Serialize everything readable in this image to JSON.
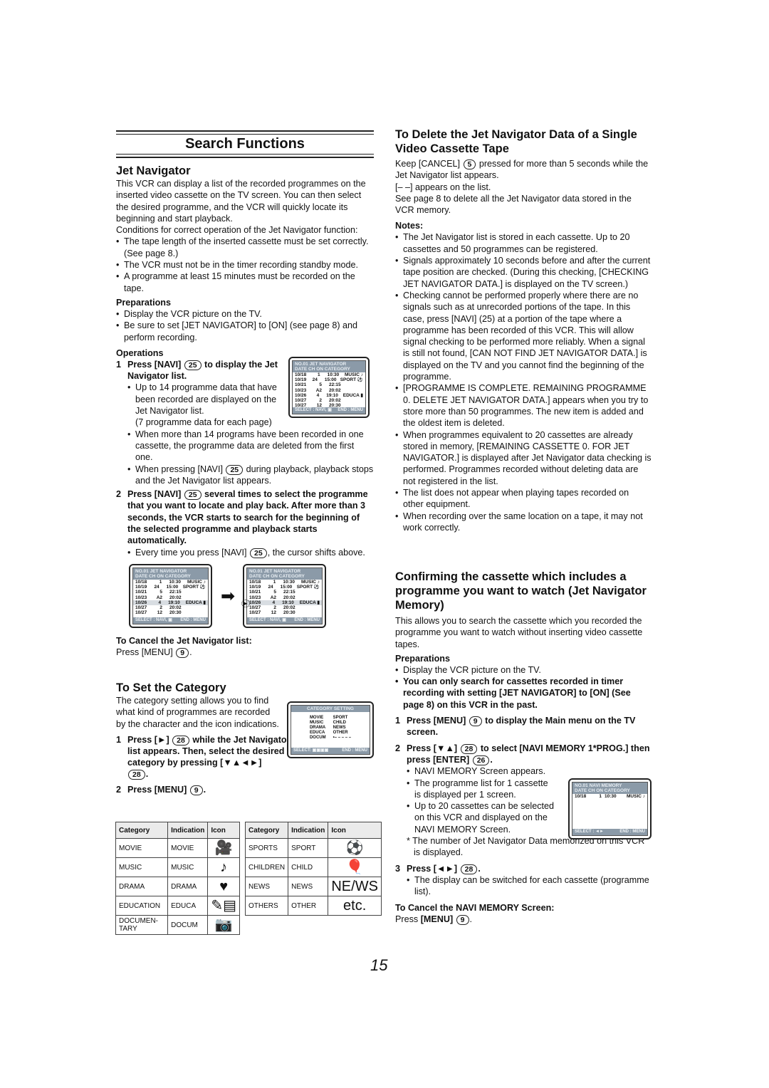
{
  "page_title": "Search Functions",
  "page_number": "15",
  "jet_navigator": {
    "heading": "Jet Navigator",
    "intro": "This VCR can display a list of the recorded programmes on the inserted video cassette on the TV screen. You can then select the desired programme, and the VCR will quickly locate its beginning and start playback.",
    "conditions_intro": "Conditions for correct operation of the Jet Navigator function:",
    "conditions": [
      "The tape length of the inserted cassette must be set correctly. (See page 8.)",
      "The VCR must not be in the timer recording standby mode.",
      "A programme at least 15 minutes must be recorded on the tape."
    ],
    "preparations_heading": "Preparations",
    "preparations": [
      "Display the VCR picture on the TV.",
      "Be sure to set [JET NAVIGATOR] to [ON] (see page 8) and perform recording."
    ],
    "operations_heading": "Operations",
    "step1": {
      "num": "1",
      "pre": "Press [NAVI]",
      "btn": "25",
      "post": "to display the Jet Navigator list."
    },
    "step1_bullet1": "Up to 14 programme data that have been recorded are displayed on the Jet Navigator list.",
    "step1_note": "(7 programme data for each page)",
    "step1_bullet2": "When more than 14 programs have been recorded in one cassette, the programme data are deleted from the first one.",
    "step1_bullet3": {
      "pre": "When pressing [NAVI]",
      "btn": "25",
      "post": "during playback, playback stops and the Jet Navigator list appears."
    },
    "step2": {
      "num": "2",
      "pre": "Press [NAVI]",
      "btn": "25",
      "post": "several times to select the programme that you want to locate and play back. After more than 3 seconds, the VCR starts to search for the beginning of the selected programme and playback starts automatically."
    },
    "step2_bullet": {
      "pre": "Every time you press [NAVI]",
      "btn": "25",
      "post": ", the cursor shifts above."
    },
    "cancel_heading": "To Cancel the Jet Navigator list:",
    "cancel_text": "Press [MENU]",
    "cancel_btn": "9"
  },
  "navi_screen": {
    "header1": "NO.01   JET   NAVIGATOR",
    "header2": "DATE    CH      ON     CATEGORY",
    "rows": [
      {
        "date": "10/18",
        "ch": "1",
        "on": "10:30",
        "cat": "MUSIC ♪"
      },
      {
        "date": "10/19",
        "ch": "24",
        "on": "15:00",
        "cat": "SPORT ⚽"
      },
      {
        "date": "10/21",
        "ch": "5",
        "on": "22:15",
        "cat": ""
      },
      {
        "date": "10/23",
        "ch": "A2",
        "on": "20:02",
        "cat": ""
      },
      {
        "date": "10/26",
        "ch": "4",
        "on": "19:10",
        "cat": "EDUCA ▮"
      },
      {
        "date": "10/27",
        "ch": "2",
        "on": "20:02",
        "cat": ""
      },
      {
        "date": "10/27",
        "ch": "12",
        "on": "20:30",
        "cat": ""
      }
    ],
    "footer_left": "SELECT : NAVI, ▣",
    "footer_right": "END : MENU",
    "arrow": "➡",
    "cursor": "►"
  },
  "category": {
    "heading": "To Set the Category",
    "intro": "The category setting allows you to find what kind of programmes are recorded by the character and the icon indications.",
    "step1": {
      "num": "1",
      "pre": "Press [►]",
      "btn": "28",
      "post": "while the Jet Navigator list appears. Then, select the desired category by pressing [▼▲◄►]",
      "btn2": "28"
    },
    "step2": {
      "num": "2",
      "pre": "Press [MENU]",
      "btn": "9"
    },
    "screen": {
      "title": "CATEGORY SETTING",
      "left": [
        "MOVIE",
        "MUSIC",
        "DRAMA",
        "EDUCA",
        "DOCUM"
      ],
      "right": [
        "SPORT",
        "CHILD",
        "NEWS",
        "OTHER",
        "•– – – – –"
      ],
      "footer_left": "SELECT: ▣▣▣▣",
      "footer_right": "END : MENU"
    },
    "table_headers": [
      "Category",
      "Indication",
      "Icon"
    ],
    "table_left": [
      {
        "category": "MOVIE",
        "indication": "MOVIE",
        "icon": "🎥"
      },
      {
        "category": "MUSIC",
        "indication": "MUSIC",
        "icon": "♪"
      },
      {
        "category": "DRAMA",
        "indication": "DRAMA",
        "icon": "♥"
      },
      {
        "category": "EDUCATION",
        "indication": "EDUCA",
        "icon": "✎▤"
      },
      {
        "category": "DOCUMEN-TARY",
        "indication": "DOCUM",
        "icon": "📷"
      }
    ],
    "table_right": [
      {
        "category": "SPORTS",
        "indication": "SPORT",
        "icon": "⚽"
      },
      {
        "category": "CHILDREN",
        "indication": "CHILD",
        "icon": "🎈"
      },
      {
        "category": "NEWS",
        "indication": "NEWS",
        "icon": "NE/WS"
      },
      {
        "category": "OTHERS",
        "indication": "OTHER",
        "icon": "etc."
      }
    ]
  },
  "delete": {
    "heading": "To Delete the Jet Navigator Data of a Single Video Cassette Tape",
    "line1_pre": "Keep [CANCEL]",
    "line1_btn": "5",
    "line1_post": "pressed for more than 5 seconds while the Jet Navigator list appears.",
    "line2": "[– –] appears on the list.",
    "line3": "See page 8 to delete all the Jet Navigator data stored in the VCR memory.",
    "notes_heading": "Notes:",
    "notes": [
      "The Jet Navigator list is stored in each cassette. Up to 20 cassettes and 50 programmes can be registered.",
      "Signals approximately 10 seconds before and after the current tape position are checked. (During this checking, [CHECKING JET NAVIGATOR DATA.] is displayed on the TV screen.)",
      "Checking cannot be performed properly where there are no signals such as at unrecorded portions of the tape. In this case, press [NAVI] (25) at a portion of the tape where a programme has been recorded of this VCR. This will allow signal checking to be performed more reliably. When a signal is still not found, [CAN NOT FIND JET NAVIGATOR DATA.] is displayed on the TV and you cannot find the beginning of the programme.",
      "[PROGRAMME IS COMPLETE. REMAINING PROGRAMME 0. DELETE JET NAVIGATOR DATA.] appears when you try to store more than 50 programmes. The new item is added and the oldest item is deleted.",
      "When programmes equivalent to 20 cassettes are already stored in memory, [REMAINING CASSETTE 0. FOR JET NAVIGATOR.] is displayed after Jet Navigator data checking is performed. Programmes recorded without deleting data are not registered in the list.",
      "The list does not appear when playing tapes recorded on other equipment.",
      "When recording over the same location on a tape, it may not work correctly."
    ]
  },
  "memory": {
    "heading": "Confirming the cassette which includes a programme you want to watch (Jet Navigator Memory)",
    "intro": "This allows you to search the cassette which you recorded the programme you want to watch without inserting video cassette tapes.",
    "preparations_heading": "Preparations",
    "prep1": "Display the VCR picture on the TV.",
    "prep2": "You can only search for cassettes recorded in timer recording with setting [JET NAVIGATOR] to [ON] (See page 8) on this VCR in the past.",
    "step1": {
      "num": "1",
      "pre": "Press [MENU]",
      "btn": "9",
      "post": "to display the Main menu on the TV screen."
    },
    "step2": {
      "num": "2",
      "pre": "Press [▼▲]",
      "btn": "28",
      "mid": "to select [NAVI MEMORY 1*PROG.] then press [ENTER]",
      "btn2": "26"
    },
    "step2_bullets": [
      "NAVI MEMORY Screen appears.",
      "The programme list for 1 cassette is displayed per 1 screen.",
      "Up to 20 cassettes can be selected on this VCR and displayed on the NAVI MEMORY Screen."
    ],
    "footnote": "* The number of Jet Navigator Data memorized on this VCR is displayed.",
    "step3": {
      "num": "3",
      "pre": "Press [◄►]",
      "btn": "28"
    },
    "step3_bullet": "The display can be switched for each cassette (programme list).",
    "cancel_heading": "To Cancel the NAVI MEMORY Screen:",
    "cancel_text": "Press",
    "cancel_key": "[MENU]",
    "cancel_btn": "9",
    "screen": {
      "header1": "NO.01   NAVI  MEMORY",
      "header2": "DATE    CH   ON        CATEGORY",
      "row": {
        "date": "10/18",
        "ch": "1",
        "on": "10:30",
        "cat": "MUSIC ♪"
      },
      "footer_left": "SELECT : ◄►",
      "footer_right": "END : MENU"
    }
  }
}
